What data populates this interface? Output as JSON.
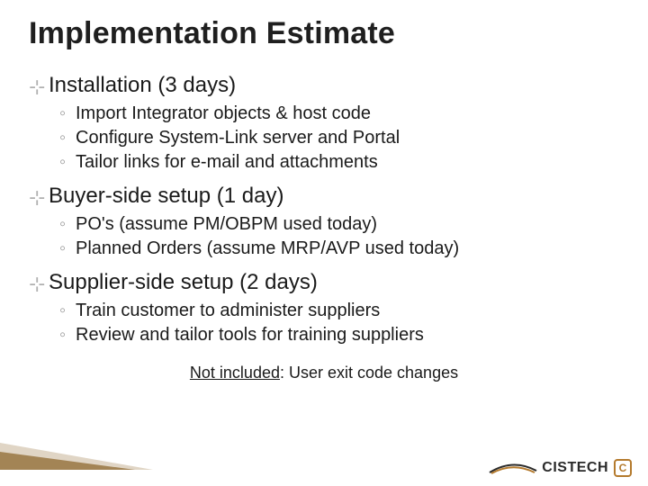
{
  "title": "Implementation Estimate",
  "sections": [
    {
      "heading": "Installation (3 days)",
      "items": [
        "Import Integrator objects & host code",
        "Configure System-Link server and Portal",
        "Tailor links for e-mail and attachments"
      ]
    },
    {
      "heading": "Buyer-side setup (1 day)",
      "items": [
        "PO's (assume PM/OBPM used today)",
        "Planned Orders (assume MRP/AVP used today)"
      ]
    },
    {
      "heading": "Supplier-side setup (2 days)",
      "items": [
        "Train customer to administer suppliers",
        "Review and tailor tools for training suppliers"
      ]
    }
  ],
  "footnote": {
    "label": "Not included",
    "text": ": User exit code changes"
  },
  "logo": {
    "name": "CISTECH",
    "mark": "C"
  },
  "colors": {
    "accent": "#b47a2d",
    "wedge_light": "#e0d5c5",
    "wedge_dark": "#a38455"
  }
}
